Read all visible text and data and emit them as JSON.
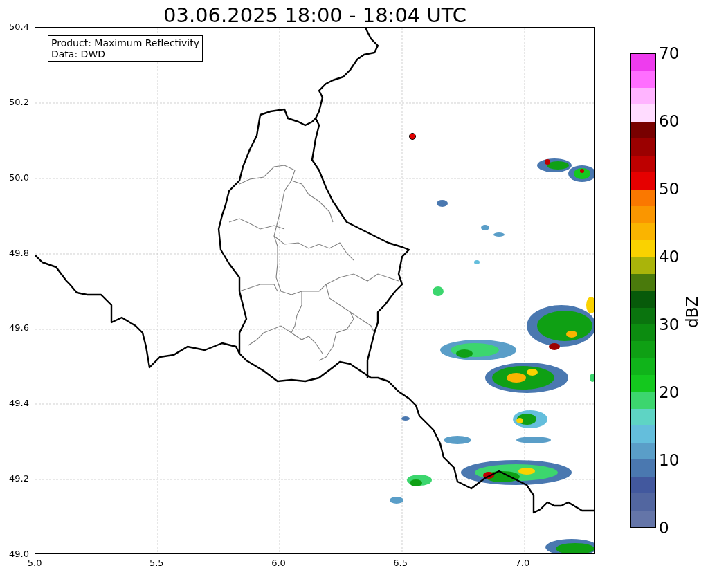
{
  "title": "03.06.2025 18:00 - 18:04 UTC",
  "info_box": [
    "Product: Maximum Reflectivity",
    "Data: DWD"
  ],
  "map": {
    "x_ticks": [
      "5.0",
      "5.5",
      "6.0",
      "6.5",
      "7.0"
    ],
    "y_ticks": [
      "50.4",
      "50.2",
      "50.0",
      "49.8",
      "49.6",
      "49.4",
      "49.2",
      "49.0"
    ]
  },
  "colorbar": {
    "label": "dBZ",
    "ticks": [
      "70",
      "60",
      "50",
      "40",
      "30",
      "20",
      "10",
      "0"
    ],
    "segments": [
      {
        "color": "#6475a8"
      },
      {
        "color": "#5266a0"
      },
      {
        "color": "#42589e"
      },
      {
        "color": "#4a78b0"
      },
      {
        "color": "#5a9ec8"
      },
      {
        "color": "#64bedc"
      },
      {
        "color": "#5ed4c4"
      },
      {
        "color": "#3cd66e"
      },
      {
        "color": "#14c81e"
      },
      {
        "color": "#10b41a"
      },
      {
        "color": "#0fa014"
      },
      {
        "color": "#0c8c10"
      },
      {
        "color": "#0a740e"
      },
      {
        "color": "#075a0a"
      },
      {
        "color": "#4a7a0c"
      },
      {
        "color": "#aab40a"
      },
      {
        "color": "#fad200"
      },
      {
        "color": "#fab400"
      },
      {
        "color": "#fa9600"
      },
      {
        "color": "#fa7800"
      },
      {
        "color": "#e60000"
      },
      {
        "color": "#be0000"
      },
      {
        "color": "#9b0000"
      },
      {
        "color": "#780000"
      },
      {
        "color": "#ffdcff"
      },
      {
        "color": "#ffb4ff"
      },
      {
        "color": "#ff6eff"
      },
      {
        "color": "#ee3cee"
      }
    ]
  }
}
